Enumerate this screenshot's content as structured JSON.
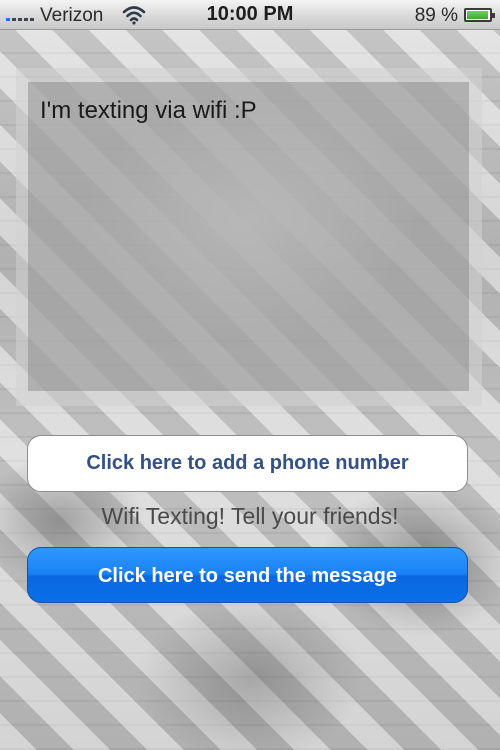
{
  "status_bar": {
    "carrier": "Verizon",
    "time": "10:00 PM",
    "battery_percent_label": "89 %",
    "battery_level": 0.89,
    "icons": {
      "signal": "signal-bars-icon",
      "wifi": "wifi-icon",
      "battery": "battery-icon"
    }
  },
  "message": {
    "text": "I'm texting via wifi :P"
  },
  "buttons": {
    "add_phone_label": "Click here to add a phone number",
    "send_label": "Click here to send the message"
  },
  "tagline": "Wifi Texting! Tell your friends!",
  "colors": {
    "send_button": "#1a82f5",
    "add_button_text": "#32508a",
    "battery_fill": "#3da82a"
  }
}
